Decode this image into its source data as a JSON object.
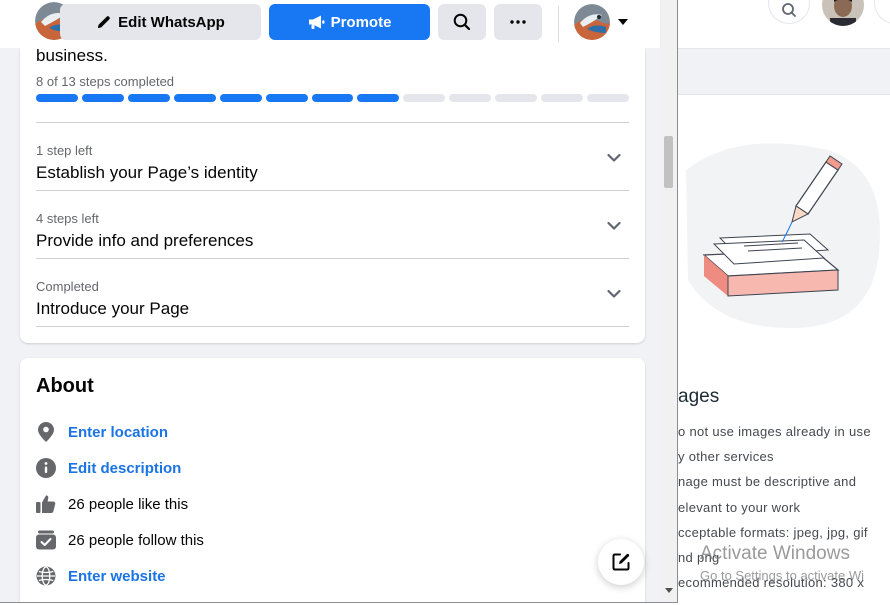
{
  "header": {
    "edit_button_label": "Edit WhatsApp",
    "promote_button_label": "Promote"
  },
  "setup_card": {
    "text_fragment": "business.",
    "progress_label": "8 of 13 steps completed",
    "progress": {
      "completed": 8,
      "total": 13
    },
    "steps": [
      {
        "status": "1 step left",
        "title": "Establish your Page’s identity"
      },
      {
        "status": "4 steps left",
        "title": "Provide info and preferences"
      },
      {
        "status": "Completed",
        "title": "Introduce your Page"
      }
    ]
  },
  "about": {
    "title": "About",
    "items": [
      {
        "icon": "location-pin-icon",
        "text": "Enter location",
        "link": true
      },
      {
        "icon": "info-icon",
        "text": "Edit description",
        "link": true
      },
      {
        "icon": "thumbs-up-icon",
        "text": "26 people like this",
        "link": false
      },
      {
        "icon": "follow-icon",
        "text": "26 people follow this",
        "link": false
      },
      {
        "icon": "globe-icon",
        "text": "Enter website",
        "link": true
      }
    ]
  },
  "background": {
    "heading_fragment": "ages",
    "lines": [
      "o not use images already in use",
      "y other services",
      "nage must be descriptive and",
      "elevant to your work",
      "cceptable formats: jpeg, jpg, gif",
      "nd png",
      "ecommended resolution: 380 x"
    ],
    "watermark_title": "Activate Windows",
    "watermark_sub": "Go to Settings to activate Wi"
  },
  "colors": {
    "brand_blue": "#1877f2",
    "link_blue": "#1b74e4",
    "page_background": "#f0f2f5"
  }
}
